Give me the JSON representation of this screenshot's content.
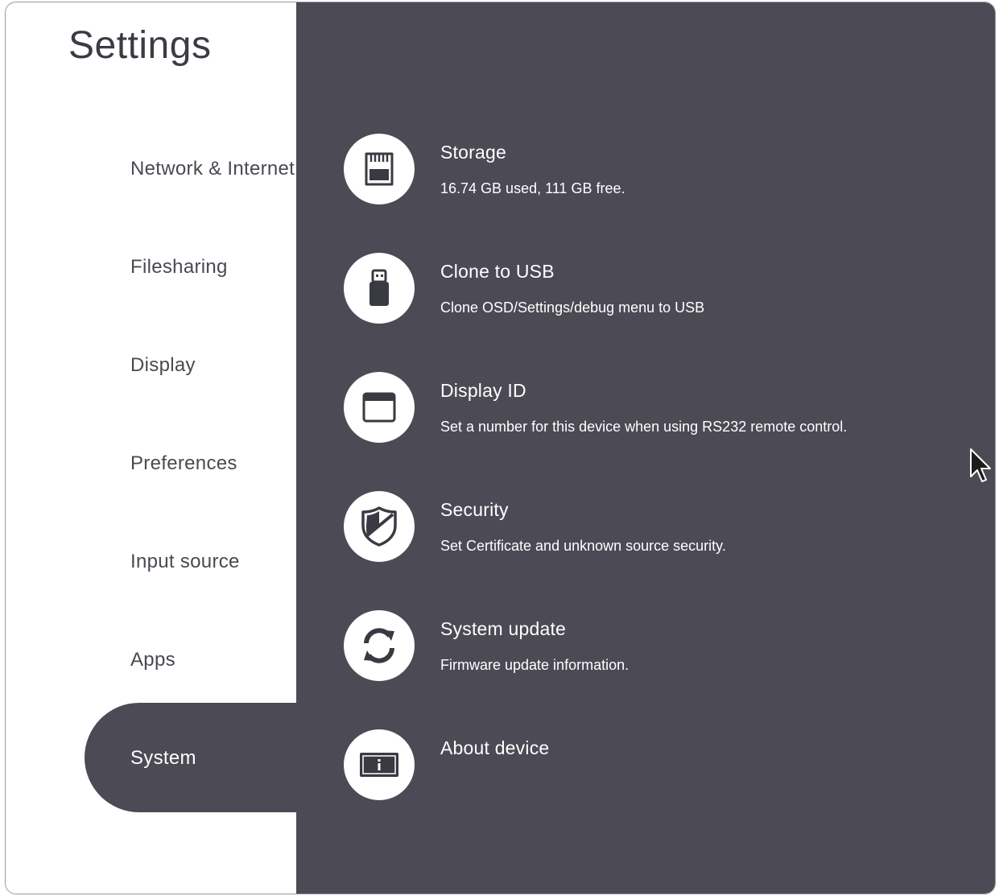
{
  "sidebar": {
    "title": "Settings",
    "items": [
      {
        "label": "Network & Internet"
      },
      {
        "label": "Filesharing"
      },
      {
        "label": "Display"
      },
      {
        "label": "Preferences"
      },
      {
        "label": "Input source"
      },
      {
        "label": "Apps"
      },
      {
        "label": "System",
        "selected": true
      }
    ]
  },
  "main": {
    "items": [
      {
        "icon": "sd-card-icon",
        "title": "Storage",
        "subtitle": "16.74 GB used, 111 GB free."
      },
      {
        "icon": "usb-drive-icon",
        "title": "Clone to USB",
        "subtitle": "Clone OSD/Settings/debug menu to USB"
      },
      {
        "icon": "display-id-icon",
        "title": "Display ID",
        "subtitle": "Set a number for this device when using RS232 remote control."
      },
      {
        "icon": "shield-icon",
        "title": "Security",
        "subtitle": "Set Certificate and unknown source security."
      },
      {
        "icon": "sync-icon",
        "title": "System update",
        "subtitle": "Firmware update information."
      },
      {
        "icon": "info-icon",
        "title": "About device",
        "subtitle": ""
      }
    ]
  },
  "colors": {
    "panel": "#4b4a55",
    "sidebar": "#ffffff",
    "text_dark": "#4a4952",
    "text_light": "#ffffff"
  }
}
